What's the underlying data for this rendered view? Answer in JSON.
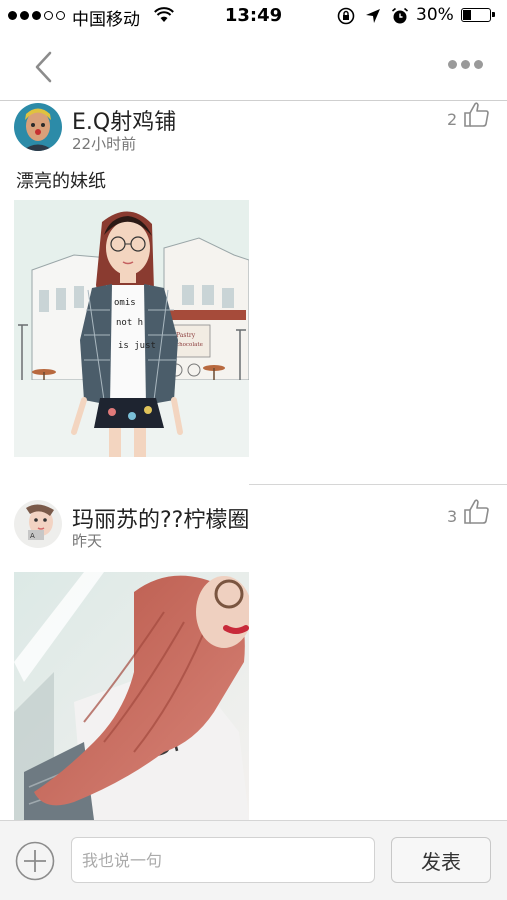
{
  "status_bar": {
    "carrier": "中国移动",
    "time": "13:49",
    "battery": "30%",
    "battery_level": 0.3
  },
  "nav": {
    "back_icon": "chevron-left-icon",
    "more_icon": "more-dots-icon"
  },
  "posts": [
    {
      "username": "E.Q射鸡铺",
      "time_ago": "22小时前",
      "likes": "2",
      "text": "漂亮的妹纸",
      "image": "illustrated-girl-cafe-street"
    },
    {
      "username": "玛丽苏的??柠檬圈",
      "time_ago": "昨天",
      "likes": "3",
      "text": "",
      "image": "selfie-girl-pink-hair"
    }
  ],
  "composer": {
    "placeholder": "我也说一句",
    "send_label": "发表",
    "add_icon": "plus-circle-icon"
  }
}
